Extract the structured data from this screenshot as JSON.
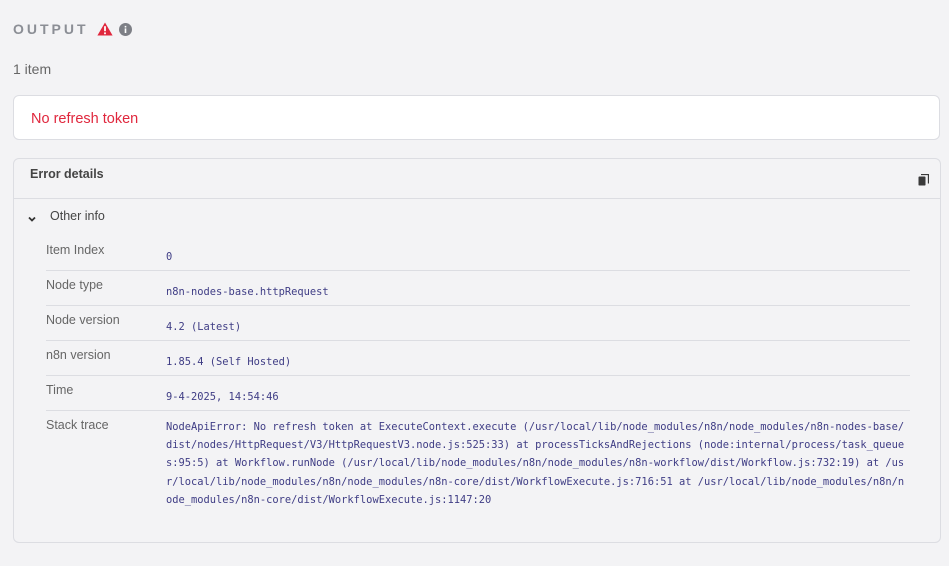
{
  "output": {
    "title": "OUTPUT",
    "warning_icon": "warning-triangle-icon",
    "info_icon": "info-circle-icon",
    "items_count": "1 item"
  },
  "error": {
    "message": "No refresh token",
    "color": "#e0273d"
  },
  "details": {
    "title": "Error details",
    "copy_icon": "copy-icon",
    "other_info_label": "Other info",
    "rows": [
      {
        "label": "Item Index",
        "value": "0"
      },
      {
        "label": "Node type",
        "value": "n8n-nodes-base.httpRequest"
      },
      {
        "label": "Node version",
        "value": "4.2 (Latest)"
      },
      {
        "label": "n8n version",
        "value": "1.85.4 (Self Hosted)"
      },
      {
        "label": "Time",
        "value": "9-4-2025, 14:54:46"
      },
      {
        "label": "Stack trace",
        "value": "NodeApiError: No refresh token at ExecuteContext.execute (/usr/local/lib/node_modules/n8n/node_modules/n8n-nodes-base/dist/nodes/HttpRequest/V3/HttpRequestV3.node.js:525:33) at processTicksAndRejections (node:internal/process/task_queues:95:5) at Workflow.runNode (/usr/local/lib/node_modules/n8n/node_modules/n8n-workflow/dist/Workflow.js:732:19) at /usr/local/lib/node_modules/n8n/node_modules/n8n-core/dist/WorkflowExecute.js:716:51 at /usr/local/lib/node_modules/n8n/node_modules/n8n-core/dist/WorkflowExecute.js:1147:20"
      }
    ]
  }
}
